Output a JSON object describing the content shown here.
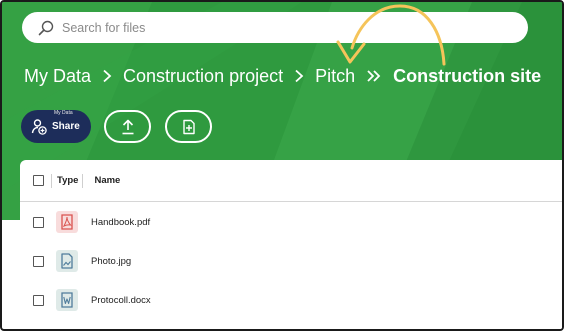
{
  "search": {
    "placeholder": "Search for files"
  },
  "breadcrumb": {
    "items": [
      "My Data",
      "Construction project",
      "Pitch"
    ],
    "current": "Construction site",
    "more_label": "⋮"
  },
  "toolbar": {
    "share_label": "Share",
    "share_tooltip": "My Data"
  },
  "table": {
    "columns": {
      "type": "Type",
      "name": "Name"
    },
    "rows": [
      {
        "name": "Handbook.pdf",
        "icon": "pdf-file-icon",
        "icon_color": "#d9534f",
        "icon_bg": "#f8dcdc"
      },
      {
        "name": "Photo.jpg",
        "icon": "image-file-icon",
        "icon_color": "#4f7c9b",
        "icon_bg": "#dfeae8"
      },
      {
        "name": "Protocoll.docx",
        "icon": "word-file-icon",
        "icon_color": "#4f7c9b",
        "icon_bg": "#dfeae8"
      }
    ]
  },
  "colors": {
    "banner": "#2f9a3f",
    "share_button": "#1d2d5a",
    "annotation_arrow": "#f5c45a"
  }
}
